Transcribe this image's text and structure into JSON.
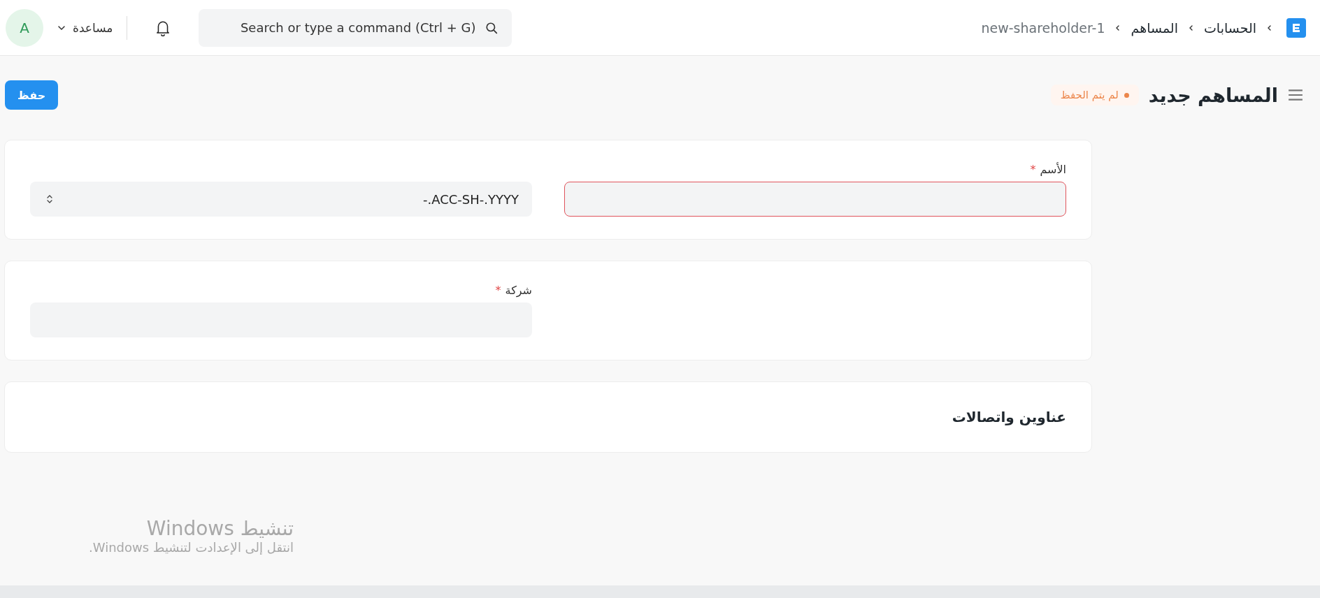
{
  "navbar": {
    "breadcrumbs": [
      {
        "label": "الحسابات",
        "current": false
      },
      {
        "label": "المساهم",
        "current": false
      },
      {
        "label": "new-shareholder-1",
        "current": true
      }
    ],
    "search": {
      "placeholder": "Search or type a command (Ctrl + G)"
    },
    "help_menu": "مساعدة",
    "avatar": "A"
  },
  "page_head": {
    "title": "المساهم جديد",
    "indicator": {
      "label": "لم يتم الحفظ",
      "color": "#ec864b"
    },
    "primary_button": "حفظ"
  },
  "sections": [
    {
      "columns": [
        {
          "fields": [
            {
              "kind": "input",
              "label": "الأسم",
              "required_mark": "*",
              "invalid": true
            }
          ]
        },
        {
          "fields": [
            {
              "kind": "select",
              "value": "-.ACC-SH-.YYYY",
              "invalid": false
            }
          ]
        }
      ]
    },
    {
      "columns": [
        {},
        {
          "fields": [
            {
              "kind": "input",
              "label": "شركة",
              "required_mark": "*",
              "invalid": false
            }
          ]
        }
      ]
    },
    {
      "heading": "عناوين واتصالات"
    }
  ],
  "os_overlay": {
    "title": "تنشيط Windows",
    "message": "انتقل إلى الإعدادت لتنشيط Windows."
  }
}
